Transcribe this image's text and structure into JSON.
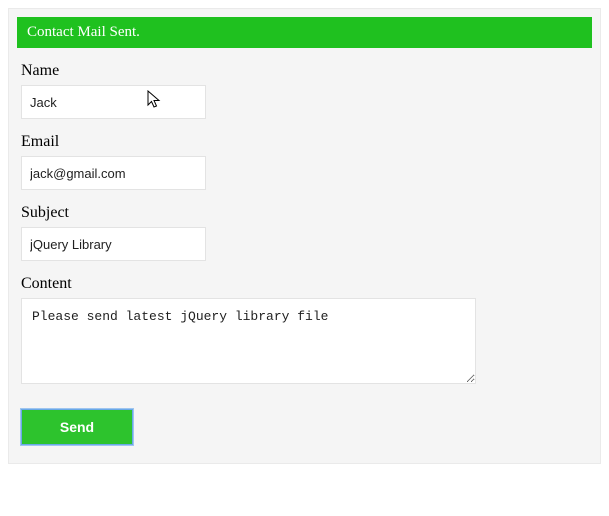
{
  "banner": {
    "message": "Contact Mail Sent."
  },
  "form": {
    "name": {
      "label": "Name",
      "value": "Jack"
    },
    "email": {
      "label": "Email",
      "value": "jack@gmail.com"
    },
    "subject": {
      "label": "Subject",
      "value": "jQuery Library"
    },
    "content": {
      "label": "Content",
      "value": "Please send latest jQuery library file"
    },
    "submit": {
      "label": "Send"
    }
  }
}
